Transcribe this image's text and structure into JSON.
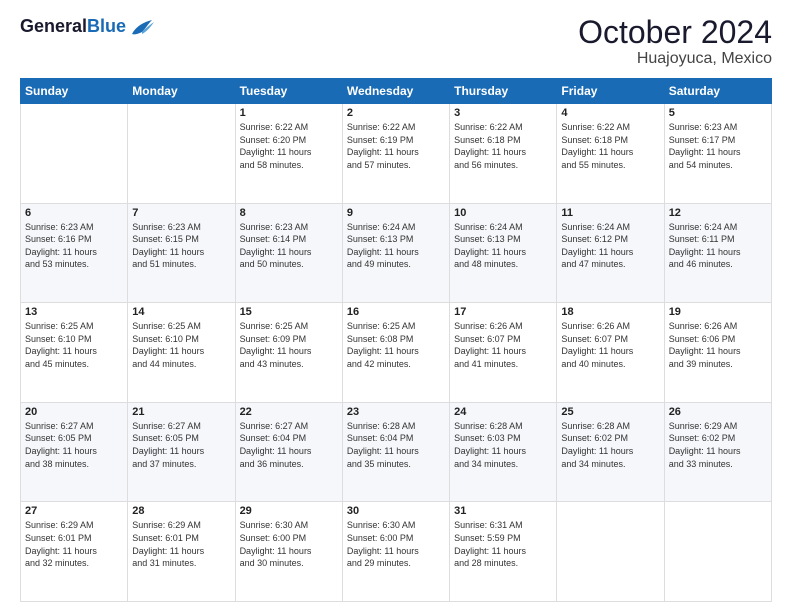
{
  "header": {
    "logo_line1": "General",
    "logo_line2": "Blue",
    "month": "October 2024",
    "location": "Huajoyuca, Mexico"
  },
  "weekdays": [
    "Sunday",
    "Monday",
    "Tuesday",
    "Wednesday",
    "Thursday",
    "Friday",
    "Saturday"
  ],
  "weeks": [
    [
      {
        "day": "",
        "info": ""
      },
      {
        "day": "",
        "info": ""
      },
      {
        "day": "1",
        "info": "Sunrise: 6:22 AM\nSunset: 6:20 PM\nDaylight: 11 hours\nand 58 minutes."
      },
      {
        "day": "2",
        "info": "Sunrise: 6:22 AM\nSunset: 6:19 PM\nDaylight: 11 hours\nand 57 minutes."
      },
      {
        "day": "3",
        "info": "Sunrise: 6:22 AM\nSunset: 6:18 PM\nDaylight: 11 hours\nand 56 minutes."
      },
      {
        "day": "4",
        "info": "Sunrise: 6:22 AM\nSunset: 6:18 PM\nDaylight: 11 hours\nand 55 minutes."
      },
      {
        "day": "5",
        "info": "Sunrise: 6:23 AM\nSunset: 6:17 PM\nDaylight: 11 hours\nand 54 minutes."
      }
    ],
    [
      {
        "day": "6",
        "info": "Sunrise: 6:23 AM\nSunset: 6:16 PM\nDaylight: 11 hours\nand 53 minutes."
      },
      {
        "day": "7",
        "info": "Sunrise: 6:23 AM\nSunset: 6:15 PM\nDaylight: 11 hours\nand 51 minutes."
      },
      {
        "day": "8",
        "info": "Sunrise: 6:23 AM\nSunset: 6:14 PM\nDaylight: 11 hours\nand 50 minutes."
      },
      {
        "day": "9",
        "info": "Sunrise: 6:24 AM\nSunset: 6:13 PM\nDaylight: 11 hours\nand 49 minutes."
      },
      {
        "day": "10",
        "info": "Sunrise: 6:24 AM\nSunset: 6:13 PM\nDaylight: 11 hours\nand 48 minutes."
      },
      {
        "day": "11",
        "info": "Sunrise: 6:24 AM\nSunset: 6:12 PM\nDaylight: 11 hours\nand 47 minutes."
      },
      {
        "day": "12",
        "info": "Sunrise: 6:24 AM\nSunset: 6:11 PM\nDaylight: 11 hours\nand 46 minutes."
      }
    ],
    [
      {
        "day": "13",
        "info": "Sunrise: 6:25 AM\nSunset: 6:10 PM\nDaylight: 11 hours\nand 45 minutes."
      },
      {
        "day": "14",
        "info": "Sunrise: 6:25 AM\nSunset: 6:10 PM\nDaylight: 11 hours\nand 44 minutes."
      },
      {
        "day": "15",
        "info": "Sunrise: 6:25 AM\nSunset: 6:09 PM\nDaylight: 11 hours\nand 43 minutes."
      },
      {
        "day": "16",
        "info": "Sunrise: 6:25 AM\nSunset: 6:08 PM\nDaylight: 11 hours\nand 42 minutes."
      },
      {
        "day": "17",
        "info": "Sunrise: 6:26 AM\nSunset: 6:07 PM\nDaylight: 11 hours\nand 41 minutes."
      },
      {
        "day": "18",
        "info": "Sunrise: 6:26 AM\nSunset: 6:07 PM\nDaylight: 11 hours\nand 40 minutes."
      },
      {
        "day": "19",
        "info": "Sunrise: 6:26 AM\nSunset: 6:06 PM\nDaylight: 11 hours\nand 39 minutes."
      }
    ],
    [
      {
        "day": "20",
        "info": "Sunrise: 6:27 AM\nSunset: 6:05 PM\nDaylight: 11 hours\nand 38 minutes."
      },
      {
        "day": "21",
        "info": "Sunrise: 6:27 AM\nSunset: 6:05 PM\nDaylight: 11 hours\nand 37 minutes."
      },
      {
        "day": "22",
        "info": "Sunrise: 6:27 AM\nSunset: 6:04 PM\nDaylight: 11 hours\nand 36 minutes."
      },
      {
        "day": "23",
        "info": "Sunrise: 6:28 AM\nSunset: 6:04 PM\nDaylight: 11 hours\nand 35 minutes."
      },
      {
        "day": "24",
        "info": "Sunrise: 6:28 AM\nSunset: 6:03 PM\nDaylight: 11 hours\nand 34 minutes."
      },
      {
        "day": "25",
        "info": "Sunrise: 6:28 AM\nSunset: 6:02 PM\nDaylight: 11 hours\nand 34 minutes."
      },
      {
        "day": "26",
        "info": "Sunrise: 6:29 AM\nSunset: 6:02 PM\nDaylight: 11 hours\nand 33 minutes."
      }
    ],
    [
      {
        "day": "27",
        "info": "Sunrise: 6:29 AM\nSunset: 6:01 PM\nDaylight: 11 hours\nand 32 minutes."
      },
      {
        "day": "28",
        "info": "Sunrise: 6:29 AM\nSunset: 6:01 PM\nDaylight: 11 hours\nand 31 minutes."
      },
      {
        "day": "29",
        "info": "Sunrise: 6:30 AM\nSunset: 6:00 PM\nDaylight: 11 hours\nand 30 minutes."
      },
      {
        "day": "30",
        "info": "Sunrise: 6:30 AM\nSunset: 6:00 PM\nDaylight: 11 hours\nand 29 minutes."
      },
      {
        "day": "31",
        "info": "Sunrise: 6:31 AM\nSunset: 5:59 PM\nDaylight: 11 hours\nand 28 minutes."
      },
      {
        "day": "",
        "info": ""
      },
      {
        "day": "",
        "info": ""
      }
    ]
  ]
}
